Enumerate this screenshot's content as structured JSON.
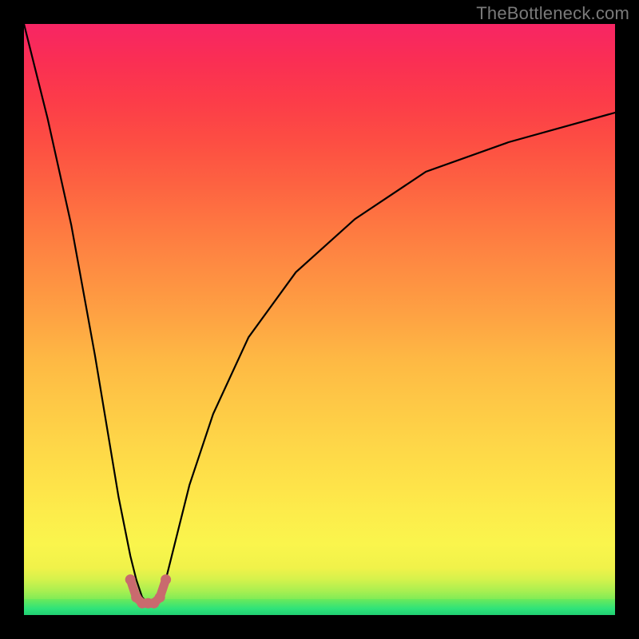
{
  "watermark": "TheBottleneck.com",
  "chart_data": {
    "type": "line",
    "title": "",
    "xlabel": "",
    "ylabel": "",
    "x_range": [
      0,
      100
    ],
    "y_range": [
      0,
      100
    ],
    "series": [
      {
        "name": "main-curve",
        "color": "#000000",
        "x": [
          0,
          4,
          8,
          12,
          14,
          16,
          18,
          19,
          20,
          21,
          22,
          23,
          24,
          25,
          26,
          28,
          32,
          38,
          46,
          56,
          68,
          82,
          100
        ],
        "y": [
          100,
          84,
          66,
          44,
          32,
          20,
          10,
          6,
          3,
          2,
          2,
          3,
          6,
          10,
          14,
          22,
          34,
          47,
          58,
          67,
          75,
          80,
          85
        ]
      },
      {
        "name": "highlight-segment",
        "color": "#c96a6e",
        "x": [
          18,
          19,
          20,
          21,
          22,
          23,
          24
        ],
        "y": [
          6,
          3,
          2,
          2,
          2,
          3,
          6
        ]
      }
    ],
    "background": {
      "type": "vertical-gradient",
      "stops": [
        {
          "pos": 0,
          "color": "#2fe37a"
        },
        {
          "pos": 8,
          "color": "#f0f24a"
        },
        {
          "pos": 22,
          "color": "#fee349"
        },
        {
          "pos": 50,
          "color": "#fea443"
        },
        {
          "pos": 80,
          "color": "#fd4e43"
        },
        {
          "pos": 100,
          "color": "#f72564"
        }
      ]
    }
  }
}
